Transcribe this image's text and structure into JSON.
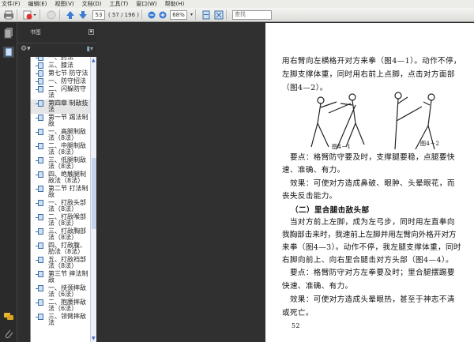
{
  "menu": [
    "文件(F)",
    "编辑(E)",
    "视图(V)",
    "文档(D)",
    "工具(T)",
    "窗口(W)",
    "帮助(H)"
  ],
  "toolbar": {
    "page_input": "53",
    "page_count": "( 57 / 196 )",
    "zoom": "68%",
    "search_placeholder": "查找"
  },
  "panel": {
    "title": "书签"
  },
  "bookmarks": [
    {
      "label": "一、肘法"
    },
    {
      "label": "三、膝法"
    },
    {
      "label": "第七节 防守法"
    },
    {
      "label": "一、防守招法"
    },
    {
      "label": "二、闪躲防守法"
    },
    {
      "label": "第四章 制敌技法",
      "selected": true
    },
    {
      "label": "第一节 踢法制敌"
    },
    {
      "label": "一、高腿制敌法（8法）"
    },
    {
      "label": "二、中腿制敌法（8法）"
    },
    {
      "label": "三、低腿制敌法（8法）"
    },
    {
      "label": "四、绝触腿制敌法（8法）"
    },
    {
      "label": "第二节 打法制敌"
    },
    {
      "label": "一、打敌头部法（8法）"
    },
    {
      "label": "二、打敌喉部法（8法）"
    },
    {
      "label": "三、打敌胸部法（8法）"
    },
    {
      "label": "四、打敌腹、肋法（8法）"
    },
    {
      "label": "五、打敌裆部法（8法）"
    },
    {
      "label": "第三节 摔法制敌"
    },
    {
      "label": "一、挟颈摔敌法（6法）"
    },
    {
      "label": "二、抱腰摔敌法（6法）"
    },
    {
      "label": "三、领臂摔敌法"
    }
  ],
  "document": {
    "lines": [
      "用右臂向左横格开对方来拳（图4—1）。动作不停，",
      "左脚支撑体重，同时用右前上点脚，点击对方面部",
      "（图4—2）。"
    ],
    "fig1": "图4－1",
    "fig2": "图4－2",
    "lines2": [
      "　要点：格臂防守要及时，支撑腿要稳，点腿要快",
      "速、准确、有力。",
      "　效果：可使对方造成鼻破、眼肿、头晕眼花，而",
      "丧失反击能力。"
    ],
    "heading": "（二）里合腿击敌头部",
    "lines3": [
      "　当对方前上左脚，成为左弓步，同时用左直拳向",
      "我胸部击来时，我速前上左脚并用左臂向外格开对方",
      "来拳（图4—3）。动作不停，我左腿支撑体重，同时",
      "右脚向前上、向右里合腿击对方头部（图4—4）。",
      "　要点：格臂防守对方左拳要及时；里合腿摆踢要",
      "快速、准确、有力。",
      "　效果：可使对方造成头晕眼热，甚至于神志不清",
      "或死亡。"
    ],
    "page_number": "52"
  }
}
